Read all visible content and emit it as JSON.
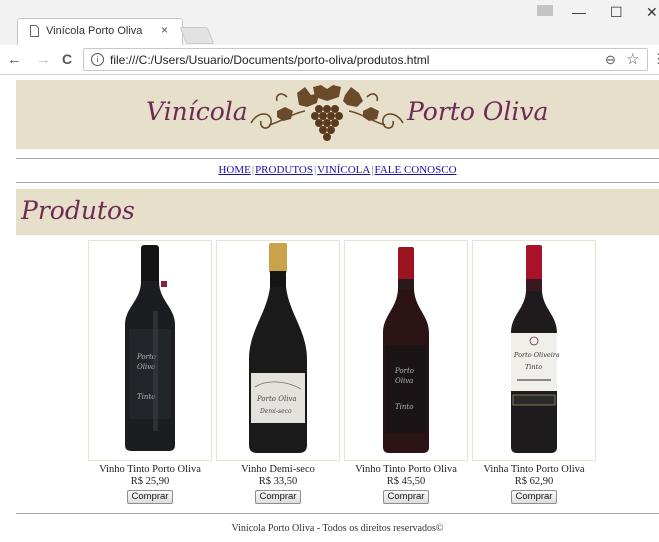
{
  "browser": {
    "tab_title": "Vinícola Porto Oliva",
    "tab_close": "×",
    "url": "file:///C:/Users/Usuario/Documents/porto-oliva/produtos.html",
    "info_glyph": "i",
    "window_controls": {
      "minimize": "—",
      "maximize": "☐",
      "close": "✕"
    },
    "nav": {
      "back": "←",
      "forward": "→",
      "reload": "C"
    },
    "zoom_glyph": "⊖",
    "star_glyph": "☆",
    "menu_glyph": "⋮"
  },
  "site": {
    "brand_left": "Vinícola",
    "brand_right": "Porto Oliva",
    "menu": [
      "HOME",
      "PRODUTOS",
      "VINÍCOLA",
      "FALE CONOSCO"
    ],
    "menu_sep": "|",
    "section_title": "Produtos",
    "footer": "Vinícola Porto Oliva - Todos os direitos reservados©"
  },
  "products": [
    {
      "name": "Vinho Tinto Porto Oliva",
      "price": "R$ 25,90",
      "button": "Comprar"
    },
    {
      "name": "Vinho Demi-seco",
      "price": "R$ 33,50",
      "button": "Comprar"
    },
    {
      "name": "Vinho Tinto Porto Oliva",
      "price": "R$ 45,50",
      "button": "Comprar"
    },
    {
      "name": "Vinha Tinto Porto Oliva",
      "price": "R$ 62,90",
      "button": "Comprar"
    }
  ],
  "colors": {
    "brand": "#6e2a55",
    "header_bg": "#e6e0cb",
    "link": "#1a0dab"
  },
  "icons": [
    "page-icon",
    "close-icon",
    "back-icon",
    "forward-icon",
    "reload-icon",
    "info-icon",
    "zoom-icon",
    "star-icon",
    "menu-icon"
  ]
}
